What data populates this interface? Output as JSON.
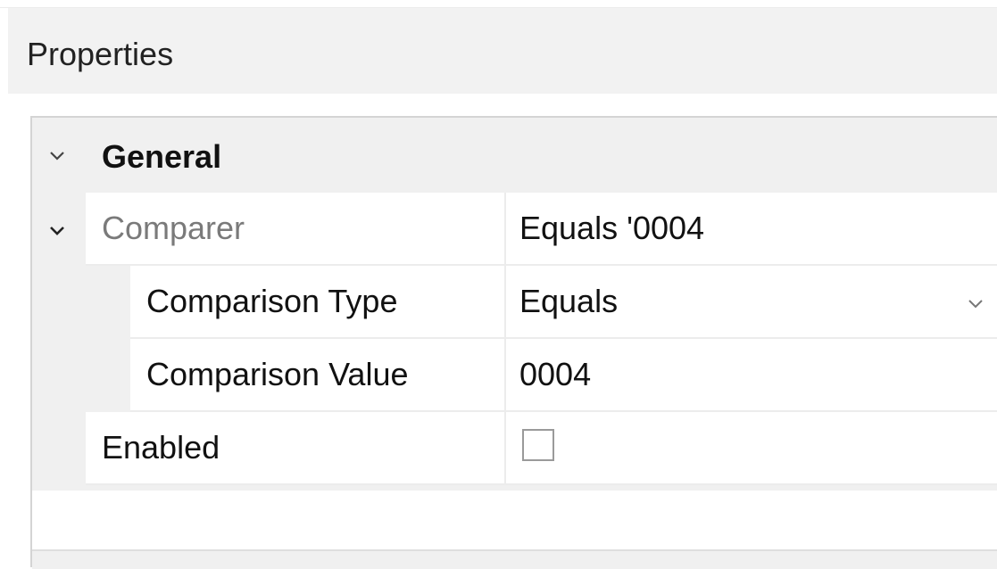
{
  "panel": {
    "title": "Properties"
  },
  "category": {
    "label": "General",
    "expanded": true,
    "chevron_icon": "chevron-down-icon"
  },
  "properties": {
    "comparer": {
      "name": "Comparer",
      "value": "Equals '0004",
      "expanded": true,
      "chevron_icon": "chevron-down-icon"
    },
    "comparison_type": {
      "name": "Comparison Type",
      "value": "Equals",
      "dropdown_icon": "chevron-down-icon"
    },
    "comparison_value": {
      "name": "Comparison Value",
      "value": "0004"
    },
    "enabled": {
      "name": "Enabled",
      "checked": false
    }
  },
  "colors": {
    "header_bg": "#f2f2f2",
    "category_bg": "#f0f0f0",
    "muted_label": "#7a7a7a",
    "grid_line": "#ececec"
  }
}
